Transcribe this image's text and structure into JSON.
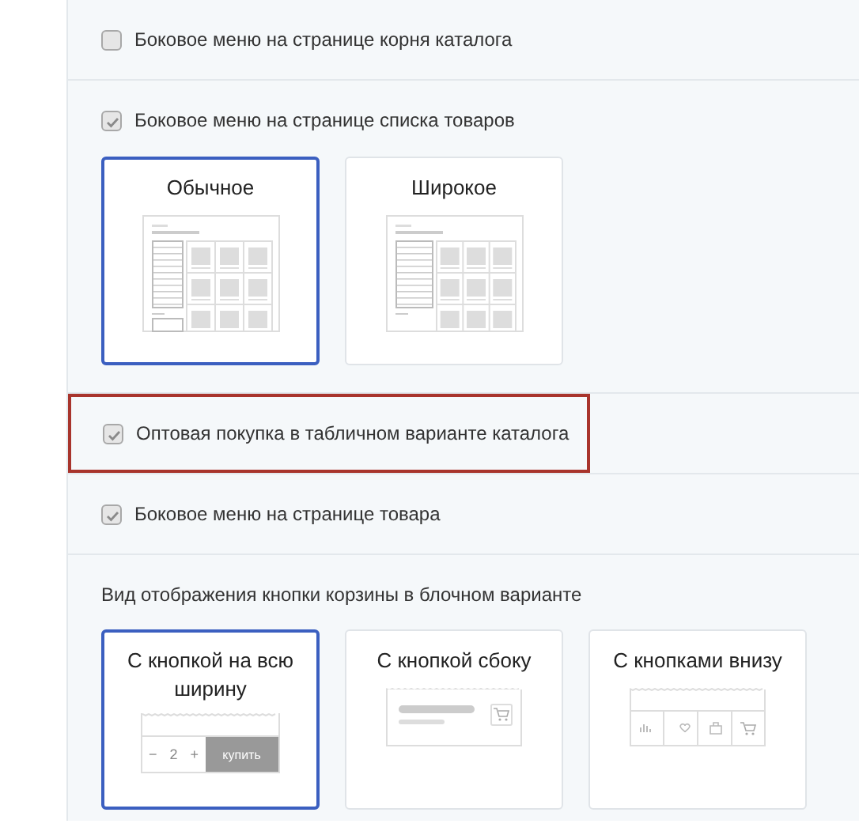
{
  "sections": [
    {
      "kind": "checkbox",
      "label": "Боковое меню на странице корня каталога",
      "checked": false,
      "highlighted": false
    },
    {
      "kind": "checkbox",
      "label": "Боковое меню на странице списка товаров",
      "checked": true,
      "highlighted": false,
      "options": [
        {
          "label": "Обычное",
          "selected": true,
          "kind": "layout-normal"
        },
        {
          "label": "Широкое",
          "selected": false,
          "kind": "layout-wide"
        }
      ]
    },
    {
      "kind": "checkbox",
      "label": "Оптовая покупка в табличном варианте каталога",
      "checked": true,
      "highlighted": true
    },
    {
      "kind": "checkbox",
      "label": "Боковое меню на странице товара",
      "checked": true,
      "highlighted": false
    },
    {
      "kind": "choice",
      "title": "Вид отображения кнопки корзины в блочном варианте",
      "options": [
        {
          "label": "С кнопкой на всю ширину",
          "selected": true,
          "kind": "buy-full",
          "minus": "−",
          "quantity": "2",
          "plus": "+",
          "buy": "купить"
        },
        {
          "label": "С кнопкой сбоку",
          "selected": false,
          "kind": "buy-side"
        },
        {
          "label": "С кнопками внизу",
          "selected": false,
          "kind": "buy-bottom"
        }
      ]
    }
  ]
}
